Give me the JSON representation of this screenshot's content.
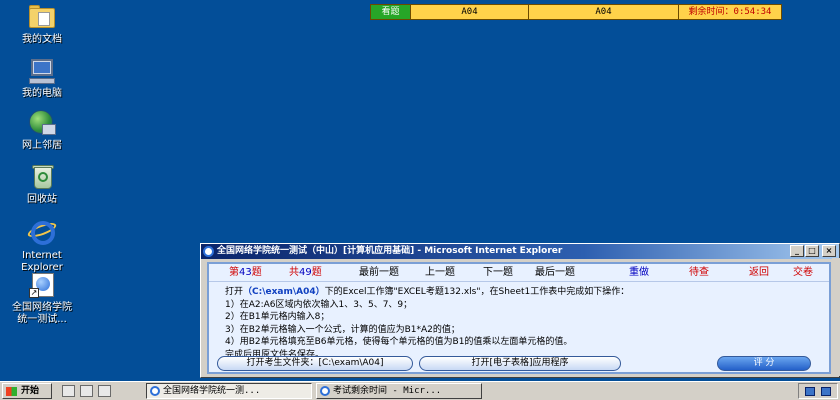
{
  "desktop": {
    "icons": [
      {
        "label": "我的文档",
        "icon": "my-documents-icon"
      },
      {
        "label": "我的电脑",
        "icon": "my-computer-icon"
      },
      {
        "label": "网上邻居",
        "icon": "network-places-icon"
      },
      {
        "label": "回收站",
        "icon": "recycle-bin-icon"
      },
      {
        "label": "Internet\nExplorer",
        "icon": "internet-explorer-icon"
      },
      {
        "label": "全国网络学院\n统一测试...",
        "icon": "exam-shortcut-icon"
      }
    ]
  },
  "timer_bar": {
    "look_label": "看题",
    "question_code_1": "A04",
    "question_code_2": "A04",
    "remaining_label": "剩余时间：0:54:34"
  },
  "window": {
    "title": "全国网络学院统一测试（中山）[计算机应用基础] - Microsoft Internet Explorer",
    "title_buttons": {
      "minimize": "_",
      "maximize": "□",
      "close": "×"
    },
    "nav": {
      "current_prefix": "第",
      "current_num": "43",
      "current_suffix": "题",
      "total_prefix": "共",
      "total_num": "49",
      "total_suffix": "题",
      "first": "最前一题",
      "prev": "上一题",
      "next": "下一题",
      "last": "最后一题",
      "redo": "重做",
      "review": "待查",
      "back": "返回",
      "submit": "交卷"
    },
    "instructions": {
      "line1_pre": "打开",
      "line1_path": "（C:\\exam\\A04）",
      "line1_post": "下的Excel工作簿\"EXCEL考题132.xls\"，在Sheet1工作表中完成如下操作：",
      "line2": "1）在A2:A6区域内依次输入1、3、5、7、9；",
      "line3": "2）在B1单元格内输入8；",
      "line4": "3）在B2单元格输入一个公式，计算的值应为B1*A2的值；",
      "line5": "4）用B2单元格填充至B6单元格，使得每个单元格的值为B1的值乘以左面单元格的值。",
      "line6": "完成后用原文件名保存。"
    },
    "buttons": {
      "open_folder": "打开考生文件夹：[C:\\exam\\A04]",
      "open_app": "打开[电子表格]应用程序",
      "score": "评  分"
    }
  },
  "taskbar": {
    "start_label": "开始",
    "tasks": [
      {
        "label": "全国网络学院统一测...",
        "active": true
      },
      {
        "label": "考试剩余时间 - Micr...",
        "active": false
      }
    ]
  }
}
